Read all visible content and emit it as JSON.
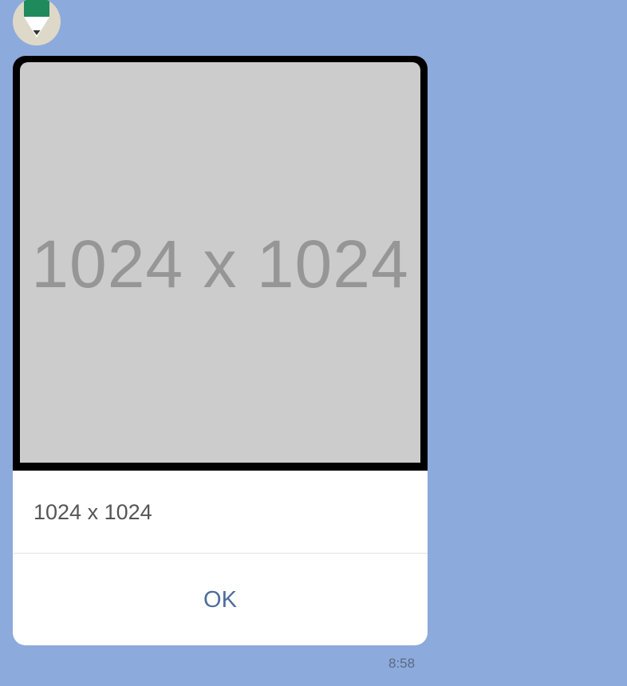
{
  "avatar": {
    "icon": "pencil-heart-icon",
    "background": "#ddd8c8",
    "accent": "#1f8a5c"
  },
  "message": {
    "image_text": "1024 x 1024",
    "title": "1024 x 1024",
    "button_label": "OK",
    "timestamp": "8:58"
  },
  "colors": {
    "chat_background": "#8caadc",
    "card_background": "#ffffff",
    "placeholder_background": "#cccccc",
    "button_text": "#4e6d9b"
  }
}
